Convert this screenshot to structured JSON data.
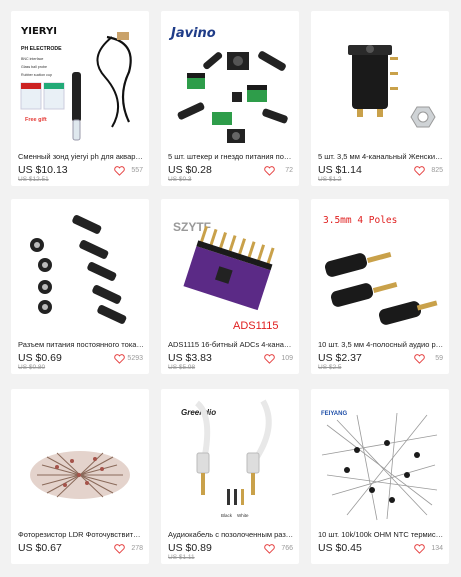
{
  "products": [
    {
      "title": "Сменный зонд yieryi ph для аквариума...",
      "price": "US $10.13",
      "old_price": "US $12.51",
      "likes": "557",
      "image_text": {
        "brand": "YIERYI",
        "label": "PH ELECTRODE",
        "lines": [
          "BNC interface",
          "Glass ball probe",
          "Rubber suction cup"
        ],
        "gift": "Free gift"
      }
    },
    {
      "title": "5 шт. штекер и гнездо питания постоя...",
      "price": "US $0.28",
      "old_price": "US $0.3",
      "likes": "72",
      "image_text": {
        "brand": "Javino"
      }
    },
    {
      "title": "5 шт. 3,5 мм 4-канальный Женский сте...",
      "price": "US $1.14",
      "old_price": "US $1.2",
      "likes": "825",
      "image_text": {}
    },
    {
      "title": "Разъем питания постоянного тока 5,5 ...",
      "price": "US $0.69",
      "old_price": "US $0.80",
      "likes": "5293",
      "image_text": {}
    },
    {
      "title": "ADS1115 16-битный ADCs 4-канальны...",
      "price": "US $3.83",
      "old_price": "US $5.98",
      "likes": "109",
      "image_text": {
        "brand": "SZYTF",
        "label": "ADS1115"
      }
    },
    {
      "title": "10 шт. 3,5 мм 4-полосный аудио разъ...",
      "price": "US $2.37",
      "old_price": "US $2.5",
      "likes": "59",
      "image_text": {
        "brand": "3.5mm 4 Poles"
      }
    },
    {
      "title": "Фоторезистор LDR Фоточувствитель...",
      "price": "US $0.67",
      "old_price": "",
      "likes": "278",
      "image_text": {}
    },
    {
      "title": "Аудиокабель с позолоченным разъем...",
      "price": "US $0.89",
      "old_price": "US $1.11",
      "likes": "766",
      "image_text": {
        "brand": "Greendio",
        "labels": [
          "Black",
          "White"
        ]
      }
    },
    {
      "title": "10 шт. 10k/100k OHM NTC термисторн...",
      "price": "US $0.45",
      "old_price": "",
      "likes": "134",
      "image_text": {
        "brand": "FEIYANG"
      }
    }
  ],
  "colors": {
    "heart": "#e64545",
    "accent_red": "#e02020",
    "pcb_purple": "#5b2a86"
  }
}
